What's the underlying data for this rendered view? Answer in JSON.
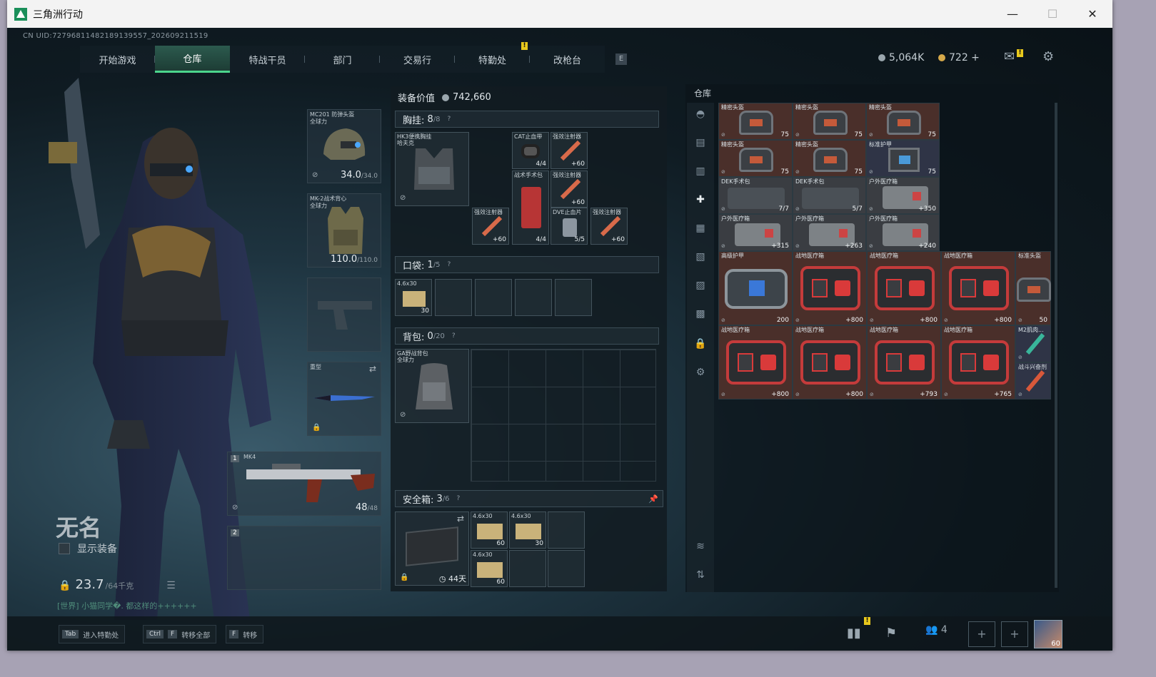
{
  "window": {
    "title": "三角洲行动",
    "minimize": "—",
    "maximize": "☐",
    "close": "✕"
  },
  "uid": "CN UID:7279681148218913955​7_202609211519",
  "nav": {
    "tabs": [
      "开始游戏",
      "仓库",
      "特战干员",
      "部门",
      "交易行",
      "特勤处",
      "改枪台"
    ],
    "active": "仓库",
    "badge": "!",
    "hotkey": "E"
  },
  "currency": {
    "coins": "5,064K",
    "tokens": "722 +",
    "mail_badge": "!"
  },
  "character": {
    "name": "无名",
    "show_equipment": "显示装备",
    "weight": "23.7",
    "weight_max": "/64千克",
    "tip": "[世界] 小猫同学�. 都这样的++++++"
  },
  "equipment": {
    "helmet": {
      "name": "MC201 防弹头盔",
      "sub": "全球力",
      "value": "34.0",
      "max": "/34.0"
    },
    "armor": {
      "name": "MK-2战术背心",
      "sub": "全球力",
      "value": "110.0",
      "max": "/110.0"
    },
    "melee": {
      "name": "重型"
    },
    "primary": {
      "slot": "1",
      "name": "MK4",
      "ammo": "48",
      "ammo_max": "/48"
    },
    "secondary": {
      "slot": "2"
    }
  },
  "loadout": {
    "value_label": "装备价值",
    "value": "742,660",
    "chest": {
      "label": "胸挂:",
      "count": "8",
      "max": "/8",
      "rig_name": "HK3便携胸挂",
      "rig_sub": "哈夫克",
      "items": [
        {
          "name": "CAT止血带",
          "cnt": "4/4"
        },
        {
          "name": "强效注射器",
          "cnt": "+60"
        },
        {
          "name": "战术手术包",
          "cnt": "4/4"
        },
        {
          "name": "强效注射器",
          "cnt": "+60"
        },
        {
          "name": "强效注射器",
          "cnt": "+60"
        },
        {
          "name": "DVE止血片",
          "cnt": "5/5"
        },
        {
          "name": "强效注射器",
          "cnt": "+60"
        }
      ]
    },
    "pocket": {
      "label": "口袋:",
      "count": "1",
      "max": "/5",
      "item": {
        "name": "4.6x30",
        "cnt": "30"
      }
    },
    "backpack": {
      "label": "背包:",
      "count": "0",
      "max": "/20",
      "name": "GA野战背包",
      "sub": "全球力"
    },
    "safe": {
      "label": "安全箱:",
      "count": "3",
      "max": "/6",
      "timer": "44天",
      "items": [
        {
          "name": "4.6x30",
          "cnt": "60"
        },
        {
          "name": "4.6x30",
          "cnt": "30"
        },
        {
          "name": "4.6x30",
          "cnt": "60"
        }
      ]
    }
  },
  "storage": {
    "title": "仓库",
    "items": [
      {
        "name": "精密头盔",
        "cnt": "75"
      },
      {
        "name": "精密头盔",
        "cnt": "75"
      },
      {
        "name": "精密头盔",
        "cnt": "75"
      },
      {
        "name": "精密头盔",
        "cnt": "75"
      },
      {
        "name": "精密头盔",
        "cnt": "75"
      },
      {
        "name": "标准护甲",
        "cnt": "75"
      },
      {
        "name": "DEK手术包",
        "cnt": "7/7"
      },
      {
        "name": "DEK手术包",
        "cnt": "5/7"
      },
      {
        "name": "户外医疗箱",
        "cnt": "+350"
      },
      {
        "name": "户外医疗箱",
        "cnt": "+315"
      },
      {
        "name": "户外医疗箱",
        "cnt": "+263"
      },
      {
        "name": "户外医疗箱",
        "cnt": "+240"
      },
      {
        "name": "高级护甲",
        "cnt": "200"
      },
      {
        "name": "战地医疗箱",
        "cnt": "+800"
      },
      {
        "name": "战地医疗箱",
        "cnt": "+800"
      },
      {
        "name": "战地医疗箱",
        "cnt": "+800"
      },
      {
        "name": "标准头盔",
        "cnt": "50"
      },
      {
        "name": "战地医疗箱",
        "cnt": "+800"
      },
      {
        "name": "战地医疗箱",
        "cnt": "+800"
      },
      {
        "name": "战地医疗箱",
        "cnt": "+793"
      },
      {
        "name": "战地医疗箱",
        "cnt": "+765"
      },
      {
        "name": "M2肌肉..."
      },
      {
        "name": "战斗兴奋剂"
      }
    ]
  },
  "bottom": {
    "buttons": [
      {
        "key": "Tab",
        "label": "进入特勤处"
      },
      {
        "key1": "Ctrl",
        "key2": "F",
        "label": "转移全部"
      },
      {
        "key": "F",
        "label": "转移"
      }
    ],
    "friends": "4",
    "level": "60"
  },
  "colors": {
    "accent": "#4cd58c",
    "storage_red": "#4a2d28",
    "med_red": "#c43b3b"
  }
}
